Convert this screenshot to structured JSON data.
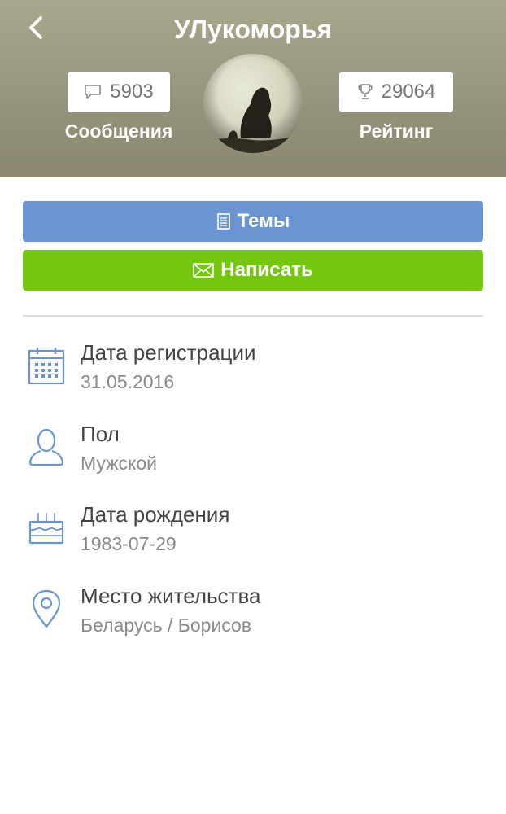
{
  "header": {
    "title": "УЛукоморья",
    "back_icon": "chevron-left-icon",
    "messages": {
      "count": "5903",
      "label": "Сообщения",
      "icon": "speech-bubble-icon"
    },
    "rating": {
      "count": "29064",
      "label": "Рейтинг",
      "icon": "trophy-icon"
    }
  },
  "actions": {
    "topics_label": "Темы",
    "topics_icon": "list-icon",
    "topics_color": "#6a95d0",
    "write_label": "Написать",
    "write_icon": "envelope-icon",
    "write_color": "#74c70e"
  },
  "info": [
    {
      "title": "Дата регистрации",
      "value": "31.05.2016",
      "icon": "calendar-icon"
    },
    {
      "title": "Пол",
      "value": "Мужской",
      "icon": "person-icon"
    },
    {
      "title": "Дата рождения",
      "value": "1983-07-29",
      "icon": "cake-icon"
    },
    {
      "title": "Место жительства",
      "value": "Беларусь / Борисов",
      "icon": "location-pin-icon"
    }
  ]
}
